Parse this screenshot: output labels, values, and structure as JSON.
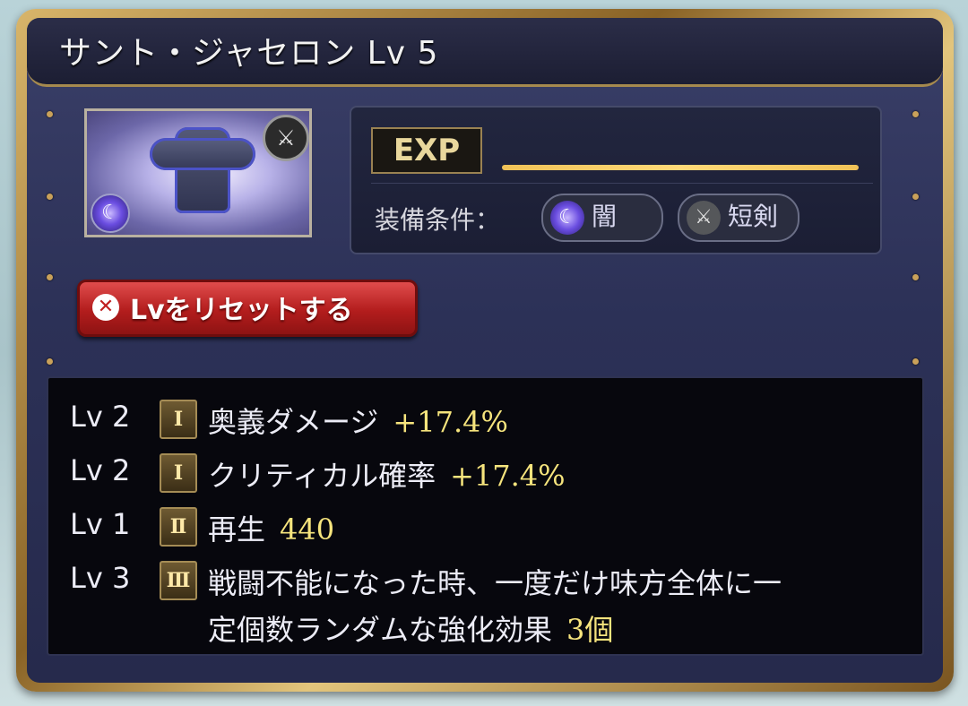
{
  "header": {
    "title": "サント・ジャセロン Lv 5"
  },
  "equipment": {
    "element_icon": "dark-element-icon",
    "weapon_icon": "dagger-icon",
    "exp_label": "EXP",
    "exp_progress": 1.0,
    "requirements_label": "装備条件：",
    "requirements": [
      {
        "label": "闇",
        "icon": "dark-element-icon"
      },
      {
        "label": "短剣",
        "icon": "dagger-icon"
      }
    ]
  },
  "reset_button": {
    "label": "Lvをリセットする",
    "icon": "close-icon"
  },
  "skills": [
    {
      "level": "Lv 2",
      "rank": "Ⅰ",
      "name": "奥義ダメージ",
      "value": "+17.4%"
    },
    {
      "level": "Lv 2",
      "rank": "Ⅰ",
      "name": "クリティカル確率",
      "value": "+17.4%"
    },
    {
      "level": "Lv 1",
      "rank": "Ⅱ",
      "name": "再生",
      "value": "440"
    },
    {
      "level": "Lv 3",
      "rank": "Ⅲ",
      "name_line1": "戦闘不能になった時、一度だけ味方全体に一",
      "name_line2": "定個数ランダムな強化効果",
      "value": "3個"
    }
  ],
  "colors": {
    "accent_gold": "#f6e47d",
    "reset_red": "#b31d1d",
    "panel_navy": "#2c3157"
  }
}
